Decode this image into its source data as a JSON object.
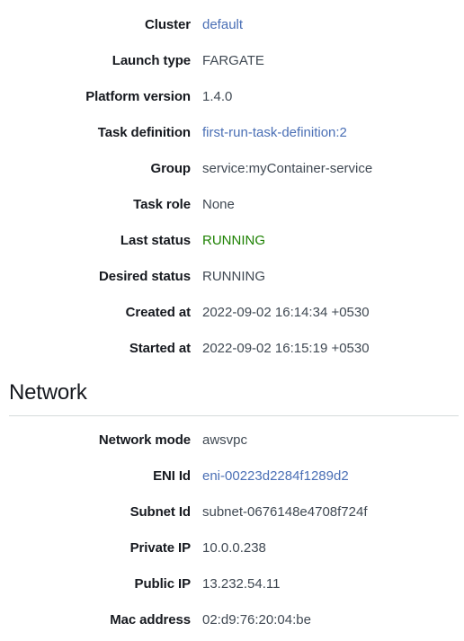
{
  "task_details": {
    "rows": [
      {
        "label": "Cluster",
        "value": "default",
        "kind": "link"
      },
      {
        "label": "Launch type",
        "value": "FARGATE",
        "kind": "text"
      },
      {
        "label": "Platform version",
        "value": "1.4.0",
        "kind": "text"
      },
      {
        "label": "Task definition",
        "value": "first-run-task-definition:2",
        "kind": "link"
      },
      {
        "label": "Group",
        "value": "service:myContainer-service",
        "kind": "text"
      },
      {
        "label": "Task role",
        "value": "None",
        "kind": "text"
      },
      {
        "label": "Last status",
        "value": "RUNNING",
        "kind": "status-ok"
      },
      {
        "label": "Desired status",
        "value": "RUNNING",
        "kind": "text"
      },
      {
        "label": "Created at",
        "value": "2022-09-02 16:14:34 +0530",
        "kind": "text"
      },
      {
        "label": "Started at",
        "value": "2022-09-02 16:15:19 +0530",
        "kind": "text"
      }
    ]
  },
  "network_section": {
    "heading": "Network",
    "rows": [
      {
        "label": "Network mode",
        "value": "awsvpc",
        "kind": "text"
      },
      {
        "label": "ENI Id",
        "value": "eni-00223d2284f1289d2",
        "kind": "link"
      },
      {
        "label": "Subnet Id",
        "value": "subnet-0676148e4708f724f",
        "kind": "text"
      },
      {
        "label": "Private IP",
        "value": "10.0.0.238",
        "kind": "text"
      },
      {
        "label": "Public IP",
        "value": "13.232.54.11",
        "kind": "text"
      },
      {
        "label": "Mac address",
        "value": "02:d9:76:20:04:be",
        "kind": "text"
      }
    ]
  },
  "colors": {
    "link": "#4a6fb5",
    "status_running": "#1d8102",
    "label_text": "#16191f",
    "value_text": "#404953",
    "divider": "#d5dbdb",
    "background": "#ffffff"
  }
}
